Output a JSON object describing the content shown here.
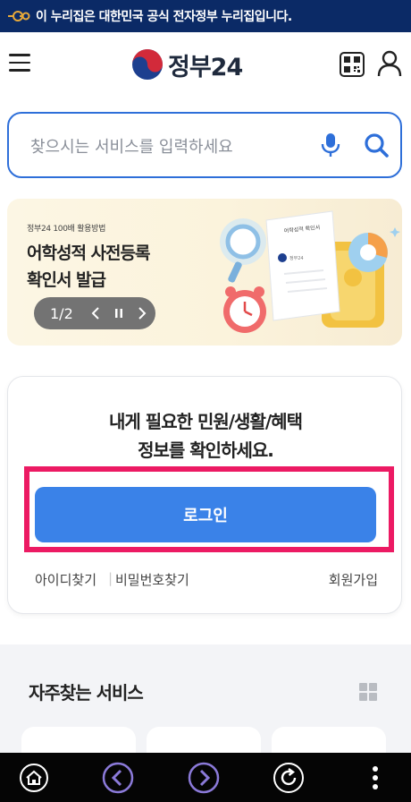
{
  "gov_banner": {
    "text": "이 누리집은 대한민국 공식 전자정부 누리집입니다."
  },
  "header": {
    "logo_text": "정부24"
  },
  "search": {
    "placeholder": "찾으시는 서비스를 입력하세요"
  },
  "promo": {
    "kicker": "정부24 100배 활용방법",
    "title": "어학성적 사전등록",
    "subtitle": "확인서 발급",
    "pager": "1/2",
    "art_doc_title": "어학성적 확인서",
    "art_doc_label": "정부24"
  },
  "login": {
    "message_line1": "내게 필요한 민원/생활/혜택",
    "message_line2": "정보를 확인하세요.",
    "button": "로그인",
    "find_id": "아이디찾기",
    "separator": "|",
    "find_password": "비밀번호찾기",
    "signup": "회원가입"
  },
  "services": {
    "title": "자주찾는 서비스"
  },
  "colors": {
    "brand_blue": "#3a82e8",
    "banner_navy": "#0b2a66",
    "highlight_pink": "#ec1a63",
    "nav_purple": "#8b7ad9"
  },
  "icons": [
    "menu-icon",
    "qr-code-icon",
    "user-icon",
    "microphone-icon",
    "search-icon",
    "chevron-left-icon",
    "pause-icon",
    "chevron-right-icon",
    "grid-icon",
    "home-icon",
    "back-icon",
    "forward-icon",
    "refresh-icon",
    "more-icon"
  ]
}
